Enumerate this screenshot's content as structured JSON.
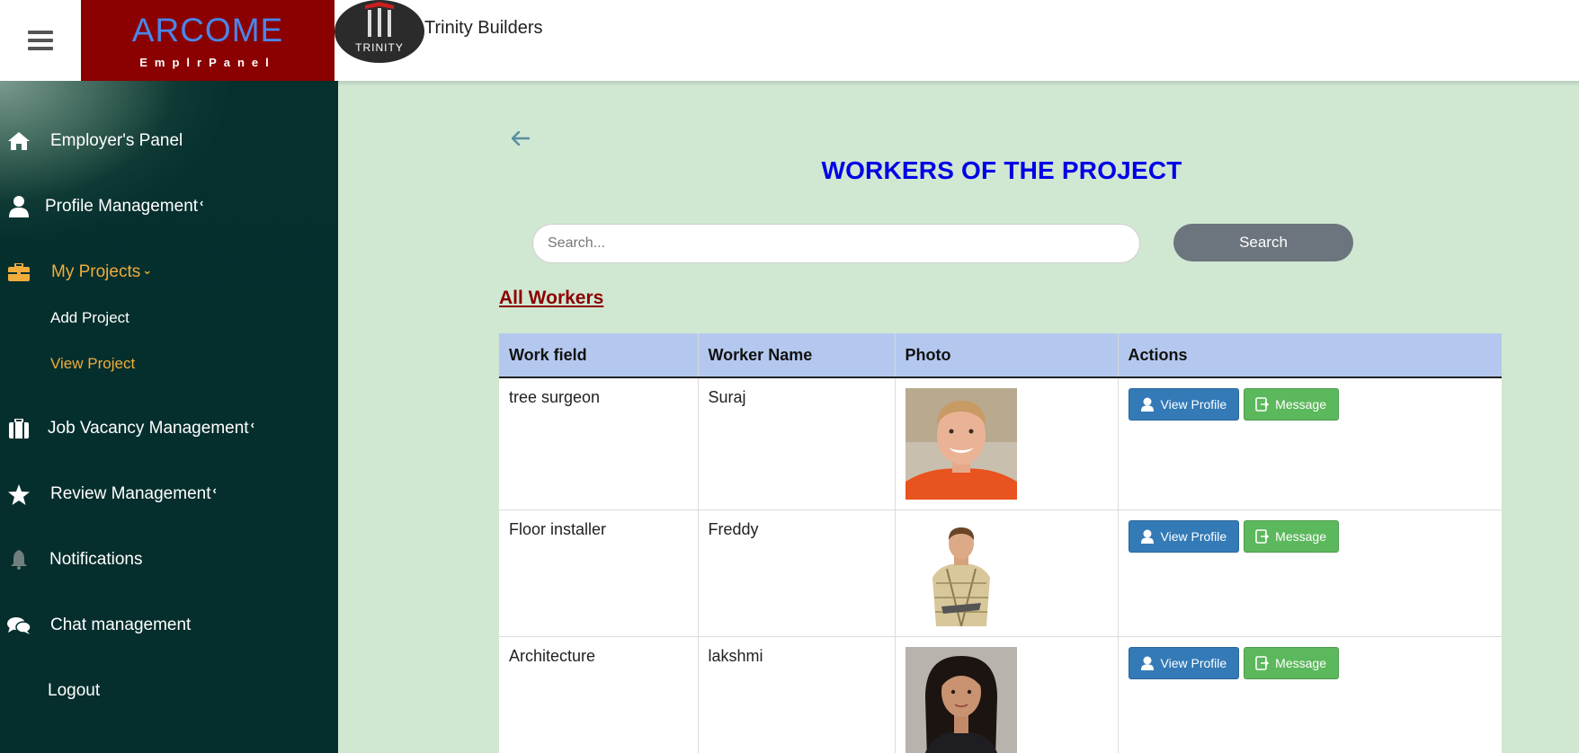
{
  "header": {
    "brand_title": "ARCOME",
    "brand_subtitle": "EmplrPanel",
    "company_logo_text": "TRINITY",
    "company_name": "Trinity Builders"
  },
  "sidebar": {
    "items": [
      {
        "label": "Employer's Panel",
        "icon": "home-icon"
      },
      {
        "label": "Profile Management",
        "icon": "user-icon",
        "chevron": "‹"
      },
      {
        "label": "My Projects",
        "icon": "briefcase-icon",
        "chevron": "⌄",
        "active": true
      },
      {
        "label": "Job Vacancy Management",
        "icon": "suitcase-icon",
        "chevron": "‹"
      },
      {
        "label": "Review Management",
        "icon": "star-icon",
        "chevron": "‹"
      },
      {
        "label": "Notifications",
        "icon": "bell-icon"
      },
      {
        "label": "Chat management",
        "icon": "chat-icon"
      },
      {
        "label": "Logout"
      }
    ],
    "subitems": [
      {
        "label": "Add Project"
      },
      {
        "label": "View Project",
        "active": true
      }
    ]
  },
  "main": {
    "title": "WORKERS OF THE PROJECT",
    "search": {
      "placeholder": "Search...",
      "value": "",
      "button_label": "Search"
    },
    "section_title": "All Workers",
    "table": {
      "headers": [
        "Work field",
        "Worker Name",
        "Photo",
        "Actions"
      ],
      "rows": [
        {
          "work_field": "tree surgeon",
          "worker_name": "Suraj"
        },
        {
          "work_field": "Floor installer",
          "worker_name": "Freddy"
        },
        {
          "work_field": "Architecture",
          "worker_name": "lakshmi"
        }
      ],
      "view_profile_label": "View Profile",
      "message_label": "Message"
    }
  },
  "colors": {
    "brand_bg": "#8b0000",
    "brand_text": "#4a86e8",
    "sidebar_bg": "#05302e",
    "active_nav": "#f0ad3c",
    "main_bg": "#d0e7d2",
    "title": "#0000e6",
    "table_header": "#b4c8ef",
    "view_button": "#337ab7",
    "message_button": "#5cb85c",
    "search_button": "#6c757d"
  }
}
